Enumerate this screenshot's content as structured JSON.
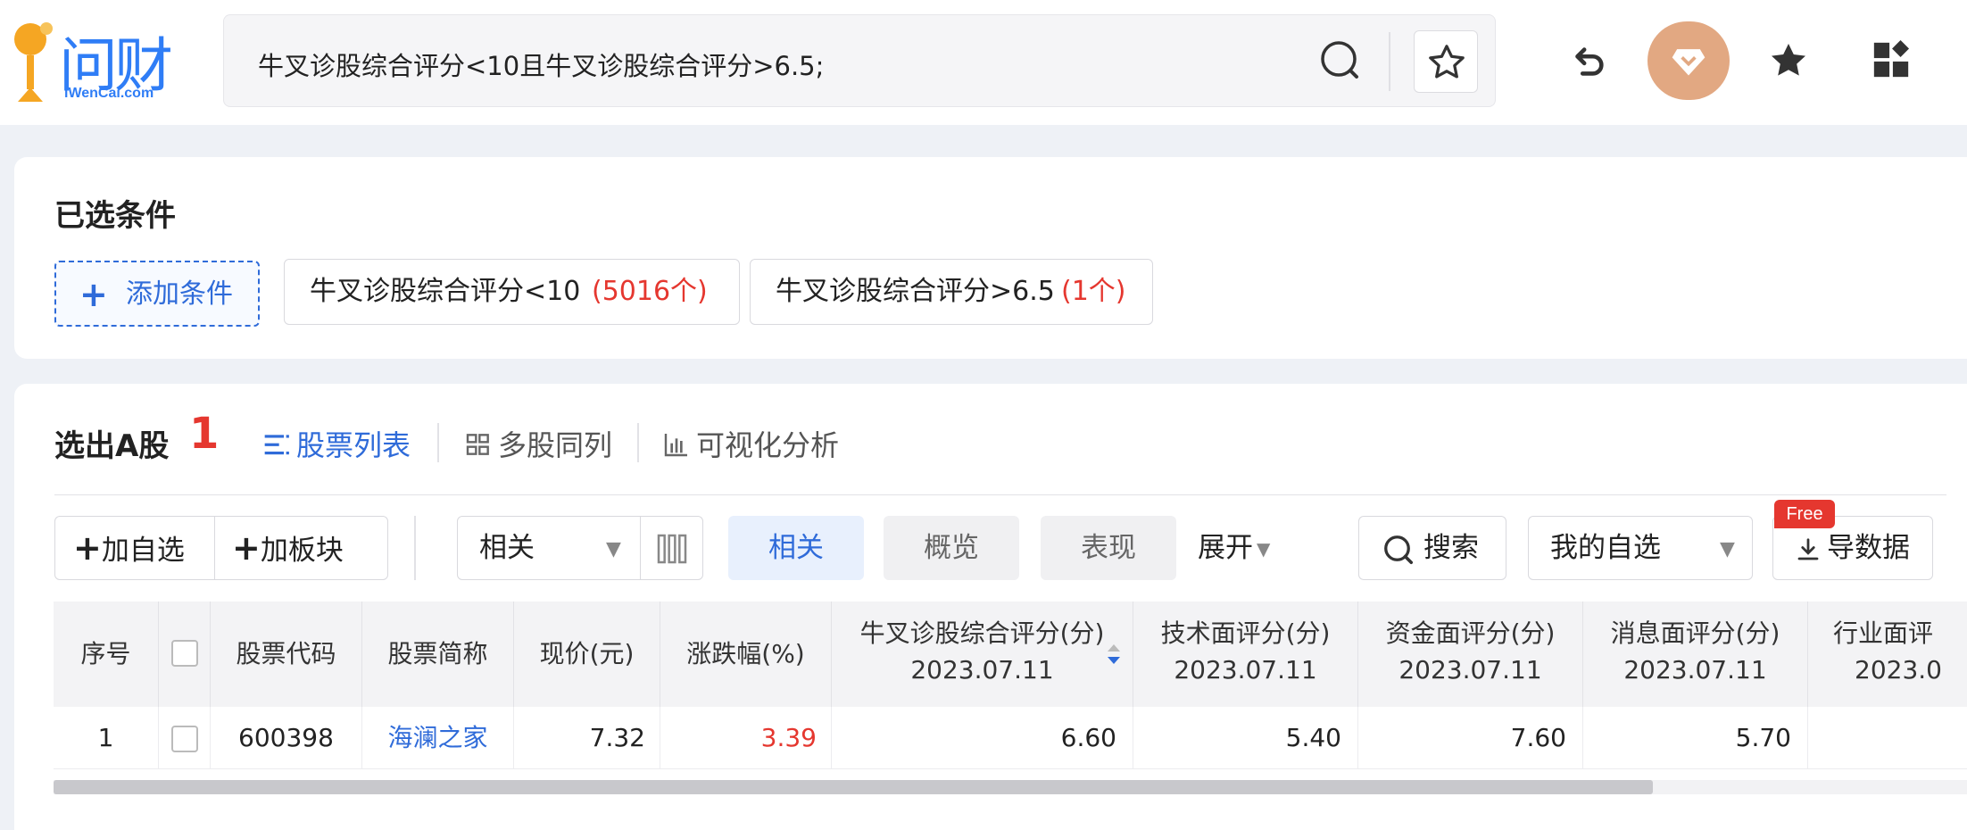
{
  "header": {
    "logo_text": "问财",
    "logo_sub": "iWenCai.com",
    "query": "牛叉诊股综合评分<10且牛叉诊股综合评分>6.5;",
    "icons": [
      "search-icon",
      "star-icon",
      "undo-icon",
      "vip-diamond-icon",
      "favorite-icon",
      "apps-icon"
    ]
  },
  "conditions": {
    "title": "已选条件",
    "add_label": "添加条件",
    "chips": [
      {
        "text": "牛叉诊股综合评分<10",
        "count": "(5016个)"
      },
      {
        "text": "牛叉诊股综合评分>6.5",
        "count": "(1个)"
      }
    ]
  },
  "results": {
    "title": "选出A股",
    "count": "1",
    "tabs": [
      {
        "label": "股票列表",
        "active": true
      },
      {
        "label": "多股同列",
        "active": false
      },
      {
        "label": "可视化分析",
        "active": false
      }
    ]
  },
  "toolbar": {
    "add_watch": "加自选",
    "add_block": "加板块",
    "sort_select": "相关",
    "view_active": "相关",
    "view_overview": "概览",
    "view_perf": "表现",
    "expand": "展开",
    "search": "搜索",
    "my_watch": "我的自选",
    "free_badge": "Free",
    "export": "导数据"
  },
  "table": {
    "headers": [
      {
        "line1": "序号",
        "line2": ""
      },
      {
        "line1": "",
        "line2": ""
      },
      {
        "line1": "股票代码",
        "line2": ""
      },
      {
        "line1": "股票简称",
        "line2": ""
      },
      {
        "line1": "现价(元)",
        "line2": ""
      },
      {
        "line1": "涨跌幅(%)",
        "line2": ""
      },
      {
        "line1": "牛叉诊股综合评分(分)",
        "line2": "2023.07.11"
      },
      {
        "line1": "技术面评分(分)",
        "line2": "2023.07.11"
      },
      {
        "line1": "资金面评分(分)",
        "line2": "2023.07.11"
      },
      {
        "line1": "消息面评分(分)",
        "line2": "2023.07.11"
      },
      {
        "line1": "行业面评",
        "line2": "2023.0"
      }
    ],
    "rows": [
      {
        "index": "1",
        "code": "600398",
        "name": "海澜之家",
        "price": "7.32",
        "change": "3.39",
        "score": "6.60",
        "tech": "5.40",
        "fund": "7.60",
        "news": "5.70",
        "industry": ""
      }
    ]
  },
  "colors": {
    "accent": "#2f6bd9",
    "up": "#e5372f",
    "badge": "#e5372f"
  }
}
